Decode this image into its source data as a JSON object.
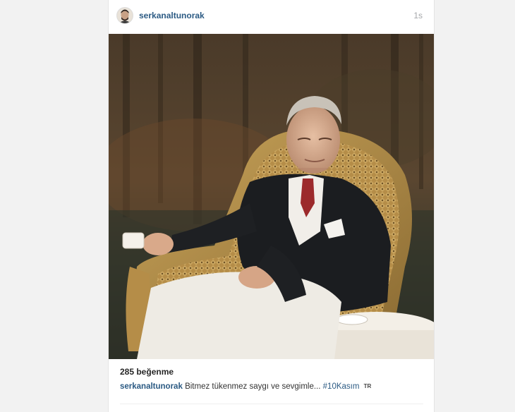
{
  "post": {
    "username": "serkanaltunorak",
    "timestamp": "1s",
    "likes": "285 beğenme",
    "caption": {
      "username": "serkanaltunorak",
      "text": "Bitmez tükenmez saygı ve sevgimle...",
      "hashtag": "#10Kasım",
      "translate_label": "TR"
    }
  },
  "photo": {
    "subject": "portrait of a man in a dark suit seated in a wicker armchair outdoors"
  }
}
